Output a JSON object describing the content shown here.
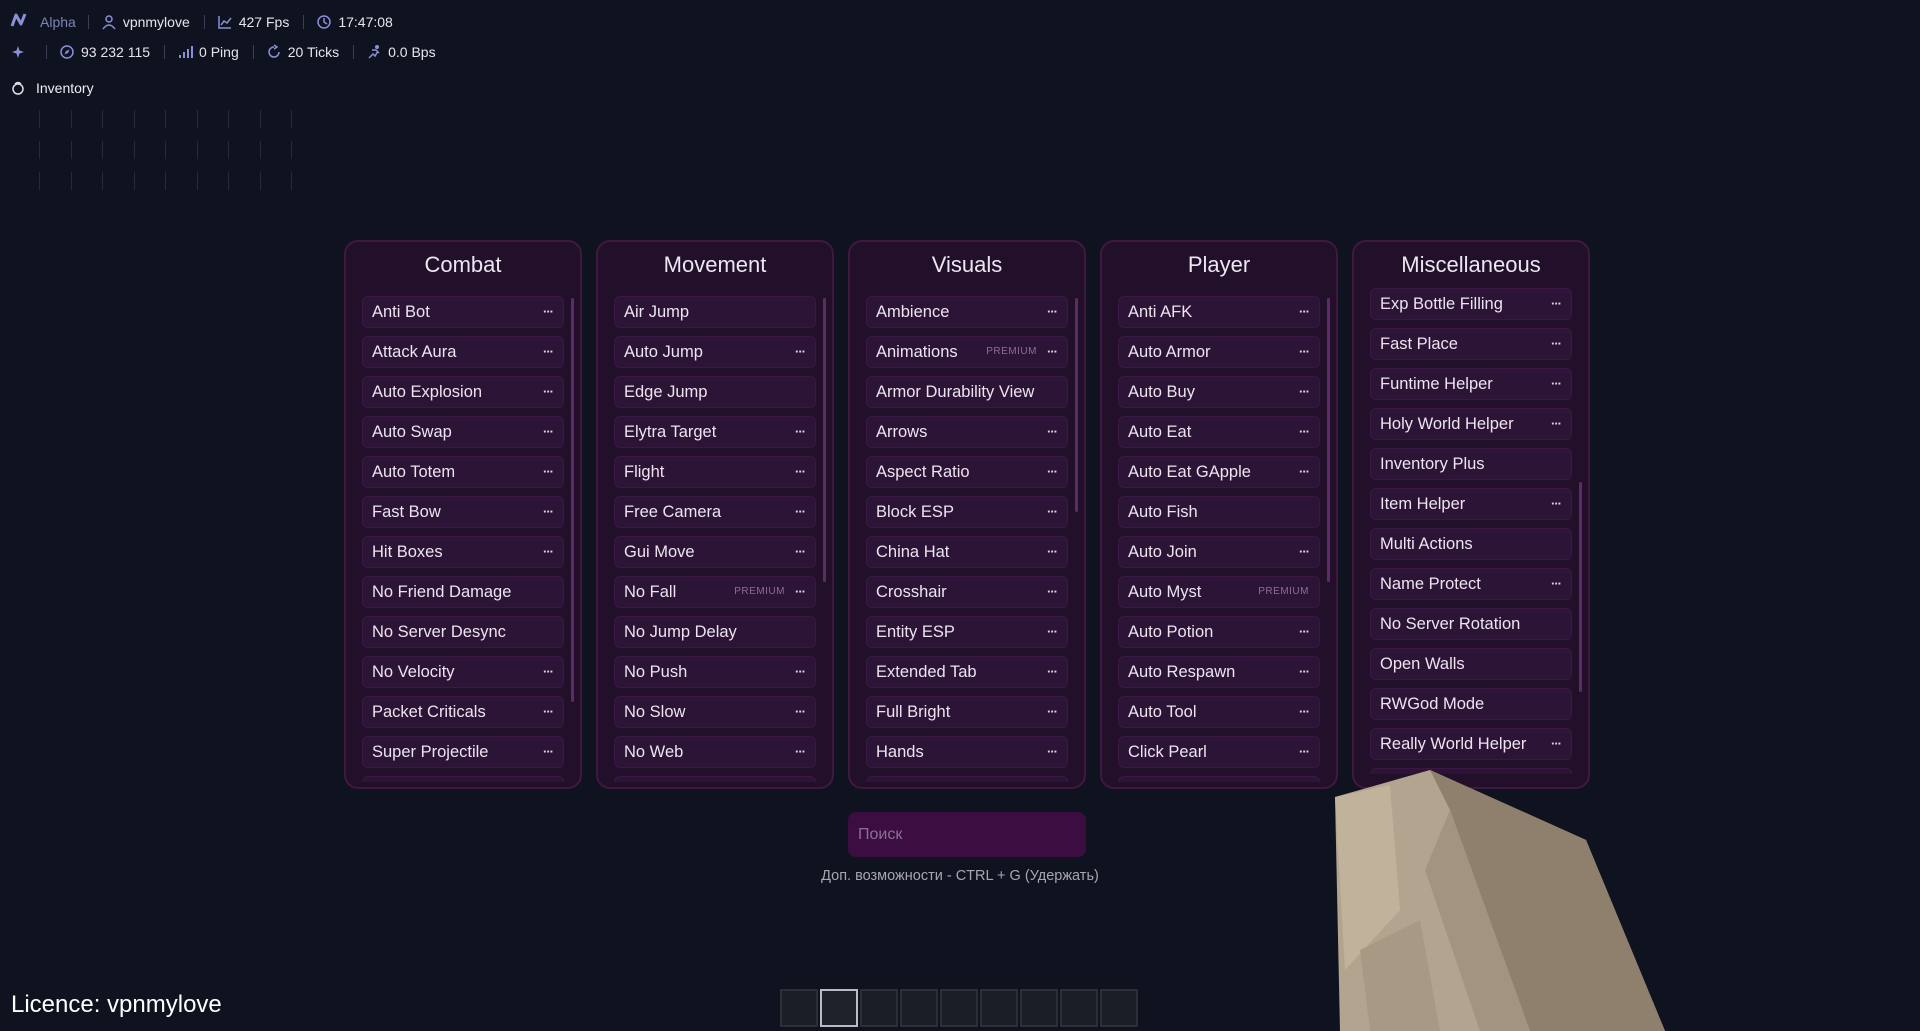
{
  "hud": {
    "brand": "Alpha",
    "username": "vpnmylove",
    "fps": "427 Fps",
    "time": "17:47:08",
    "coords": "93 232 115",
    "ping": "0 Ping",
    "ticks": "20 Ticks",
    "speed": "0.0 Bps"
  },
  "inventory": {
    "title": "Inventory"
  },
  "panels": [
    {
      "title": "Combat",
      "modules": [
        {
          "label": "Anti Bot",
          "dots": "···"
        },
        {
          "label": "Attack Aura",
          "dots": "···"
        },
        {
          "label": "Auto Explosion",
          "dots": "···"
        },
        {
          "label": "Auto Swap",
          "dots": "···"
        },
        {
          "label": "Auto Totem",
          "dots": "···"
        },
        {
          "label": "Fast Bow",
          "dots": "···"
        },
        {
          "label": "Hit Boxes",
          "dots": "···"
        },
        {
          "label": "No Friend Damage",
          "dots": ""
        },
        {
          "label": "No Server Desync",
          "dots": ""
        },
        {
          "label": "No Velocity",
          "dots": "···"
        },
        {
          "label": "Packet Criticals",
          "dots": "···"
        },
        {
          "label": "Super Projectile",
          "dots": "···"
        }
      ]
    },
    {
      "title": "Movement",
      "modules": [
        {
          "label": "Air Jump",
          "dots": ""
        },
        {
          "label": "Auto Jump",
          "dots": "···"
        },
        {
          "label": "Edge Jump",
          "dots": ""
        },
        {
          "label": "Elytra Target",
          "dots": "···"
        },
        {
          "label": "Flight",
          "dots": "···"
        },
        {
          "label": "Free Camera",
          "dots": "···"
        },
        {
          "label": "Gui Move",
          "dots": "···"
        },
        {
          "label": "No Fall",
          "dots": "···",
          "badge": "PREMIUM"
        },
        {
          "label": "No Jump Delay",
          "dots": ""
        },
        {
          "label": "No Push",
          "dots": "···"
        },
        {
          "label": "No Slow",
          "dots": "···"
        },
        {
          "label": "No Web",
          "dots": "···"
        }
      ]
    },
    {
      "title": "Visuals",
      "modules": [
        {
          "label": "Ambience",
          "dots": "···"
        },
        {
          "label": "Animations",
          "dots": "···",
          "badge": "PREMIUM"
        },
        {
          "label": "Armor Durability View",
          "dots": ""
        },
        {
          "label": "Arrows",
          "dots": "···"
        },
        {
          "label": "Aspect Ratio",
          "dots": "···"
        },
        {
          "label": "Block ESP",
          "dots": "···"
        },
        {
          "label": "China Hat",
          "dots": "···"
        },
        {
          "label": "Crosshair",
          "dots": "···"
        },
        {
          "label": "Entity ESP",
          "dots": "···"
        },
        {
          "label": "Extended Tab",
          "dots": "···"
        },
        {
          "label": "Full Bright",
          "dots": "···"
        },
        {
          "label": "Hands",
          "dots": "···"
        }
      ]
    },
    {
      "title": "Player",
      "modules": [
        {
          "label": "Anti AFK",
          "dots": "···"
        },
        {
          "label": "Auto Armor",
          "dots": "···"
        },
        {
          "label": "Auto Buy",
          "dots": "···"
        },
        {
          "label": "Auto Eat",
          "dots": "···"
        },
        {
          "label": "Auto Eat GApple",
          "dots": "···"
        },
        {
          "label": "Auto Fish",
          "dots": ""
        },
        {
          "label": "Auto Join",
          "dots": "···"
        },
        {
          "label": "Auto Myst",
          "dots": "",
          "badge": "PREMIUM"
        },
        {
          "label": "Auto Potion",
          "dots": "···"
        },
        {
          "label": "Auto Respawn",
          "dots": "···"
        },
        {
          "label": "Auto Tool",
          "dots": "···"
        },
        {
          "label": "Click Pearl",
          "dots": "···"
        }
      ]
    },
    {
      "title": "Miscellaneous",
      "modules": [
        {
          "label": "Exp Bottle Filling",
          "dots": "···"
        },
        {
          "label": "Fast Place",
          "dots": "···"
        },
        {
          "label": "Funtime Helper",
          "dots": "···"
        },
        {
          "label": "Holy World Helper",
          "dots": "···"
        },
        {
          "label": "Inventory Plus",
          "dots": ""
        },
        {
          "label": "Item Helper",
          "dots": "···"
        },
        {
          "label": "Multi Actions",
          "dots": ""
        },
        {
          "label": "Name Protect",
          "dots": "···"
        },
        {
          "label": "No Server Rotation",
          "dots": ""
        },
        {
          "label": "Open Walls",
          "dots": ""
        },
        {
          "label": "RWGod Mode",
          "dots": ""
        },
        {
          "label": "Really World Helper",
          "dots": "···"
        }
      ]
    }
  ],
  "search": {
    "placeholder": "Поиск"
  },
  "hint": "Доп. возможности - CTRL + G (Удержать)",
  "licence": "Licence: vpnmylove",
  "hotbar": {
    "slots": 9,
    "selected": 2
  },
  "colors": {
    "background": "#0f1320",
    "panel": "#22102b",
    "panel_border": "#40183f",
    "module": "#2c1436",
    "search": "#3b0d41",
    "accent": "#8a8fd8"
  }
}
